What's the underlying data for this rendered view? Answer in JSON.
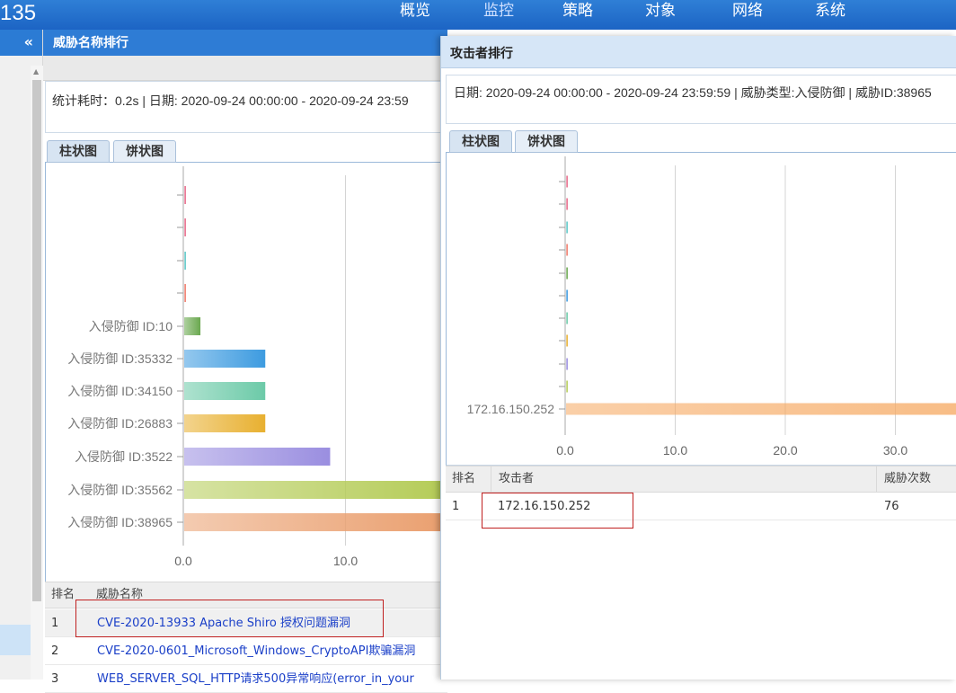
{
  "topbar": {
    "logo_text": "135",
    "nav": [
      "概览",
      "监控",
      "策略",
      "对象",
      "网络",
      "系统"
    ]
  },
  "leftnav": {
    "collapse_icon": "«"
  },
  "panel_left": {
    "title": "威胁名称排行",
    "stats": "统计耗时：0.2s | 日期: 2020-09-24 00:00:00 - 2020-09-24 23:59",
    "tabs": [
      "柱状图",
      "饼状图"
    ],
    "table_headers": [
      "排名",
      "威胁名称"
    ],
    "rows": [
      {
        "rank": "1",
        "name": "CVE-2020-13933 Apache Shiro 授权问题漏洞"
      },
      {
        "rank": "2",
        "name": "CVE-2020-0601_Microsoft_Windows_CryptoAPI欺骗漏洞"
      },
      {
        "rank": "3",
        "name": "WEB_SERVER_SQL_HTTP请求500异常响应(error_in_your"
      }
    ]
  },
  "panel_right": {
    "title": "攻击者排行",
    "stats": "日期: 2020-09-24 00:00:00 - 2020-09-24 23:59:59 | 威胁类型:入侵防御 | 威胁ID:38965",
    "tabs": [
      "柱状图",
      "饼状图"
    ],
    "table_headers": [
      "排名",
      "攻击者",
      "威胁次数"
    ],
    "rows": [
      {
        "rank": "1",
        "attacker": "172.16.150.252",
        "count": "76"
      }
    ]
  },
  "chart_data": [
    {
      "type": "bar",
      "orientation": "horizontal",
      "categories": [
        "",
        "",
        "",
        "",
        "入侵防御 ID:10",
        "入侵防御 ID:35332",
        "入侵防御 ID:34150",
        "入侵防御 ID:26883",
        "入侵防御 ID:3522",
        "入侵防御 ID:35562",
        "入侵防御 ID:38965"
      ],
      "values": [
        0.1,
        0.1,
        0.1,
        0.1,
        1,
        5,
        5,
        5,
        9,
        16,
        16
      ],
      "colors": [
        "#e86a8a",
        "#e86a8a",
        "#5cc8c8",
        "#f07a6a",
        "#6aa84f",
        "#3d9be0",
        "#6ccaa8",
        "#e8b030",
        "#9a8ee0",
        "#b5cc58",
        "#eaa070"
      ],
      "x_ticks": [
        "0.0",
        "10.0"
      ],
      "xlim": [
        0,
        16
      ],
      "grid": true
    },
    {
      "type": "bar",
      "orientation": "horizontal",
      "categories": [
        "",
        "",
        "",
        "",
        "",
        "",
        "",
        "",
        "",
        "",
        "172.16.150.252"
      ],
      "values": [
        0.1,
        0.1,
        0.1,
        0.1,
        0.1,
        0.1,
        0.1,
        0.1,
        0.1,
        0.1,
        76
      ],
      "colors": [
        "#e86a8a",
        "#e86a8a",
        "#5cc8c8",
        "#f07a6a",
        "#6aa84f",
        "#3d9be0",
        "#6ccaa8",
        "#e8b030",
        "#9a8ee0",
        "#b5cc58",
        "#f6a860"
      ],
      "x_ticks": [
        "0.0",
        "10.0",
        "20.0",
        "30.0"
      ],
      "xlim": [
        0,
        35
      ],
      "grid": true
    }
  ]
}
